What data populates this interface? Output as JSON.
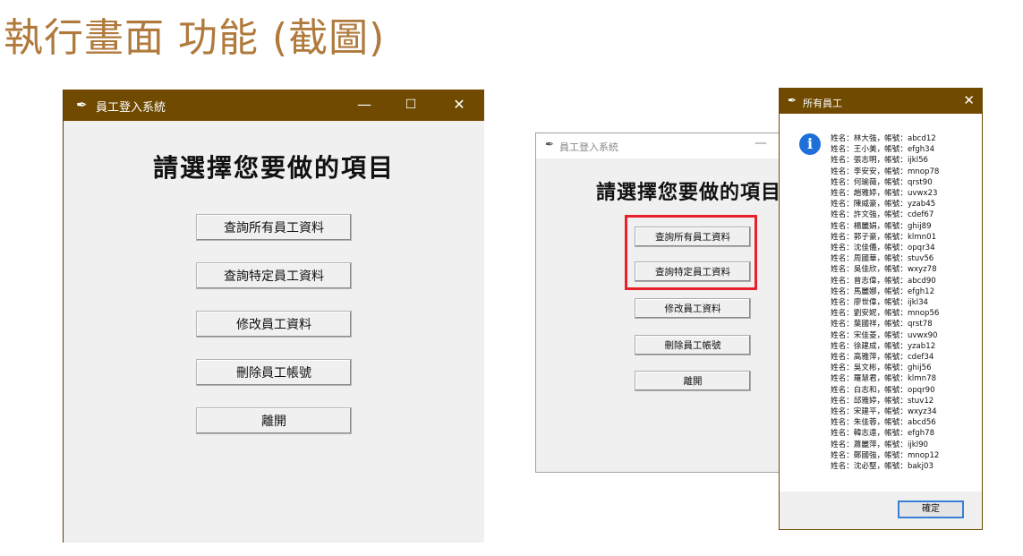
{
  "slide_title": "執行畫面 功能 (截圖)",
  "left_window": {
    "title": "員工登入系統",
    "minimize": "—",
    "maximize": "☐",
    "close": "✕",
    "heading": "請選擇您要做的項目",
    "buttons": [
      "查詢所有員工資料",
      "查詢特定員工資料",
      "修改員工資料",
      "刪除員工帳號",
      "離開"
    ]
  },
  "right_window": {
    "title": "員工登入系統",
    "minimize": "—",
    "heading": "請選擇您要做的項目",
    "buttons": [
      "查詢所有員工資料",
      "查詢特定員工資料",
      "修改員工資料",
      "刪除員工帳號",
      "離開"
    ]
  },
  "dialog": {
    "title": "所有員工",
    "close": "✕",
    "info_glyph": "i",
    "employees": [
      "姓名：林大強，帳號：abcd12",
      "姓名：王小美，帳號：efgh34",
      "姓名：張志明，帳號：ijkl56",
      "姓名：李安安，帳號：mnop78",
      "姓名：何瑜薇，帳號：qrst90",
      "姓名：趙雅婷，帳號：uvwx23",
      "姓名：陳威豪，帳號：yzab45",
      "姓名：許文強，帳號：cdef67",
      "姓名：楊麗娟，帳號：ghij89",
      "姓名：郭子豪，帳號：klmn01",
      "姓名：沈佳儀，帳號：opqr34",
      "姓名：周國華，帳號：stuv56",
      "姓名：吳佳欣，帳號：wxyz78",
      "姓名：曾志偉，帳號：abcd90",
      "姓名：馬麗娜，帳號：efgh12",
      "姓名：廖世偉，帳號：ijkl34",
      "姓名：劉安妮，帳號：mnop56",
      "姓名：葉國祥，帳號：qrst78",
      "姓名：宋佳菱，帳號：uvwx90",
      "姓名：徐建成，帳號：yzab12",
      "姓名：高雅萍，帳號：cdef34",
      "姓名：吳文彬，帳號：ghij56",
      "姓名：羅慧君，帳號：klmn78",
      "姓名：白志和，帳號：opqr90",
      "姓名：邱雅婷，帳號：stuv12",
      "姓名：宋建平，帳號：wxyz34",
      "姓名：朱佳蓉，帳號：abcd56",
      "姓名：韓志遠，帳號：efgh78",
      "姓名：蕭麗萍，帳號：ijkl90",
      "姓名：鄭國強，帳號：mnop12",
      "姓名：沈必堅，帳號：bakj03"
    ],
    "ok_label": "確定"
  },
  "colors": {
    "title_accent": "#b07a3c",
    "titlebar_brown": "#6f4a00",
    "highlight_red": "#e8202a",
    "info_blue": "#1e6fd9"
  },
  "icons": {
    "app_icon": "feather-icon",
    "info_icon": "info-icon"
  }
}
